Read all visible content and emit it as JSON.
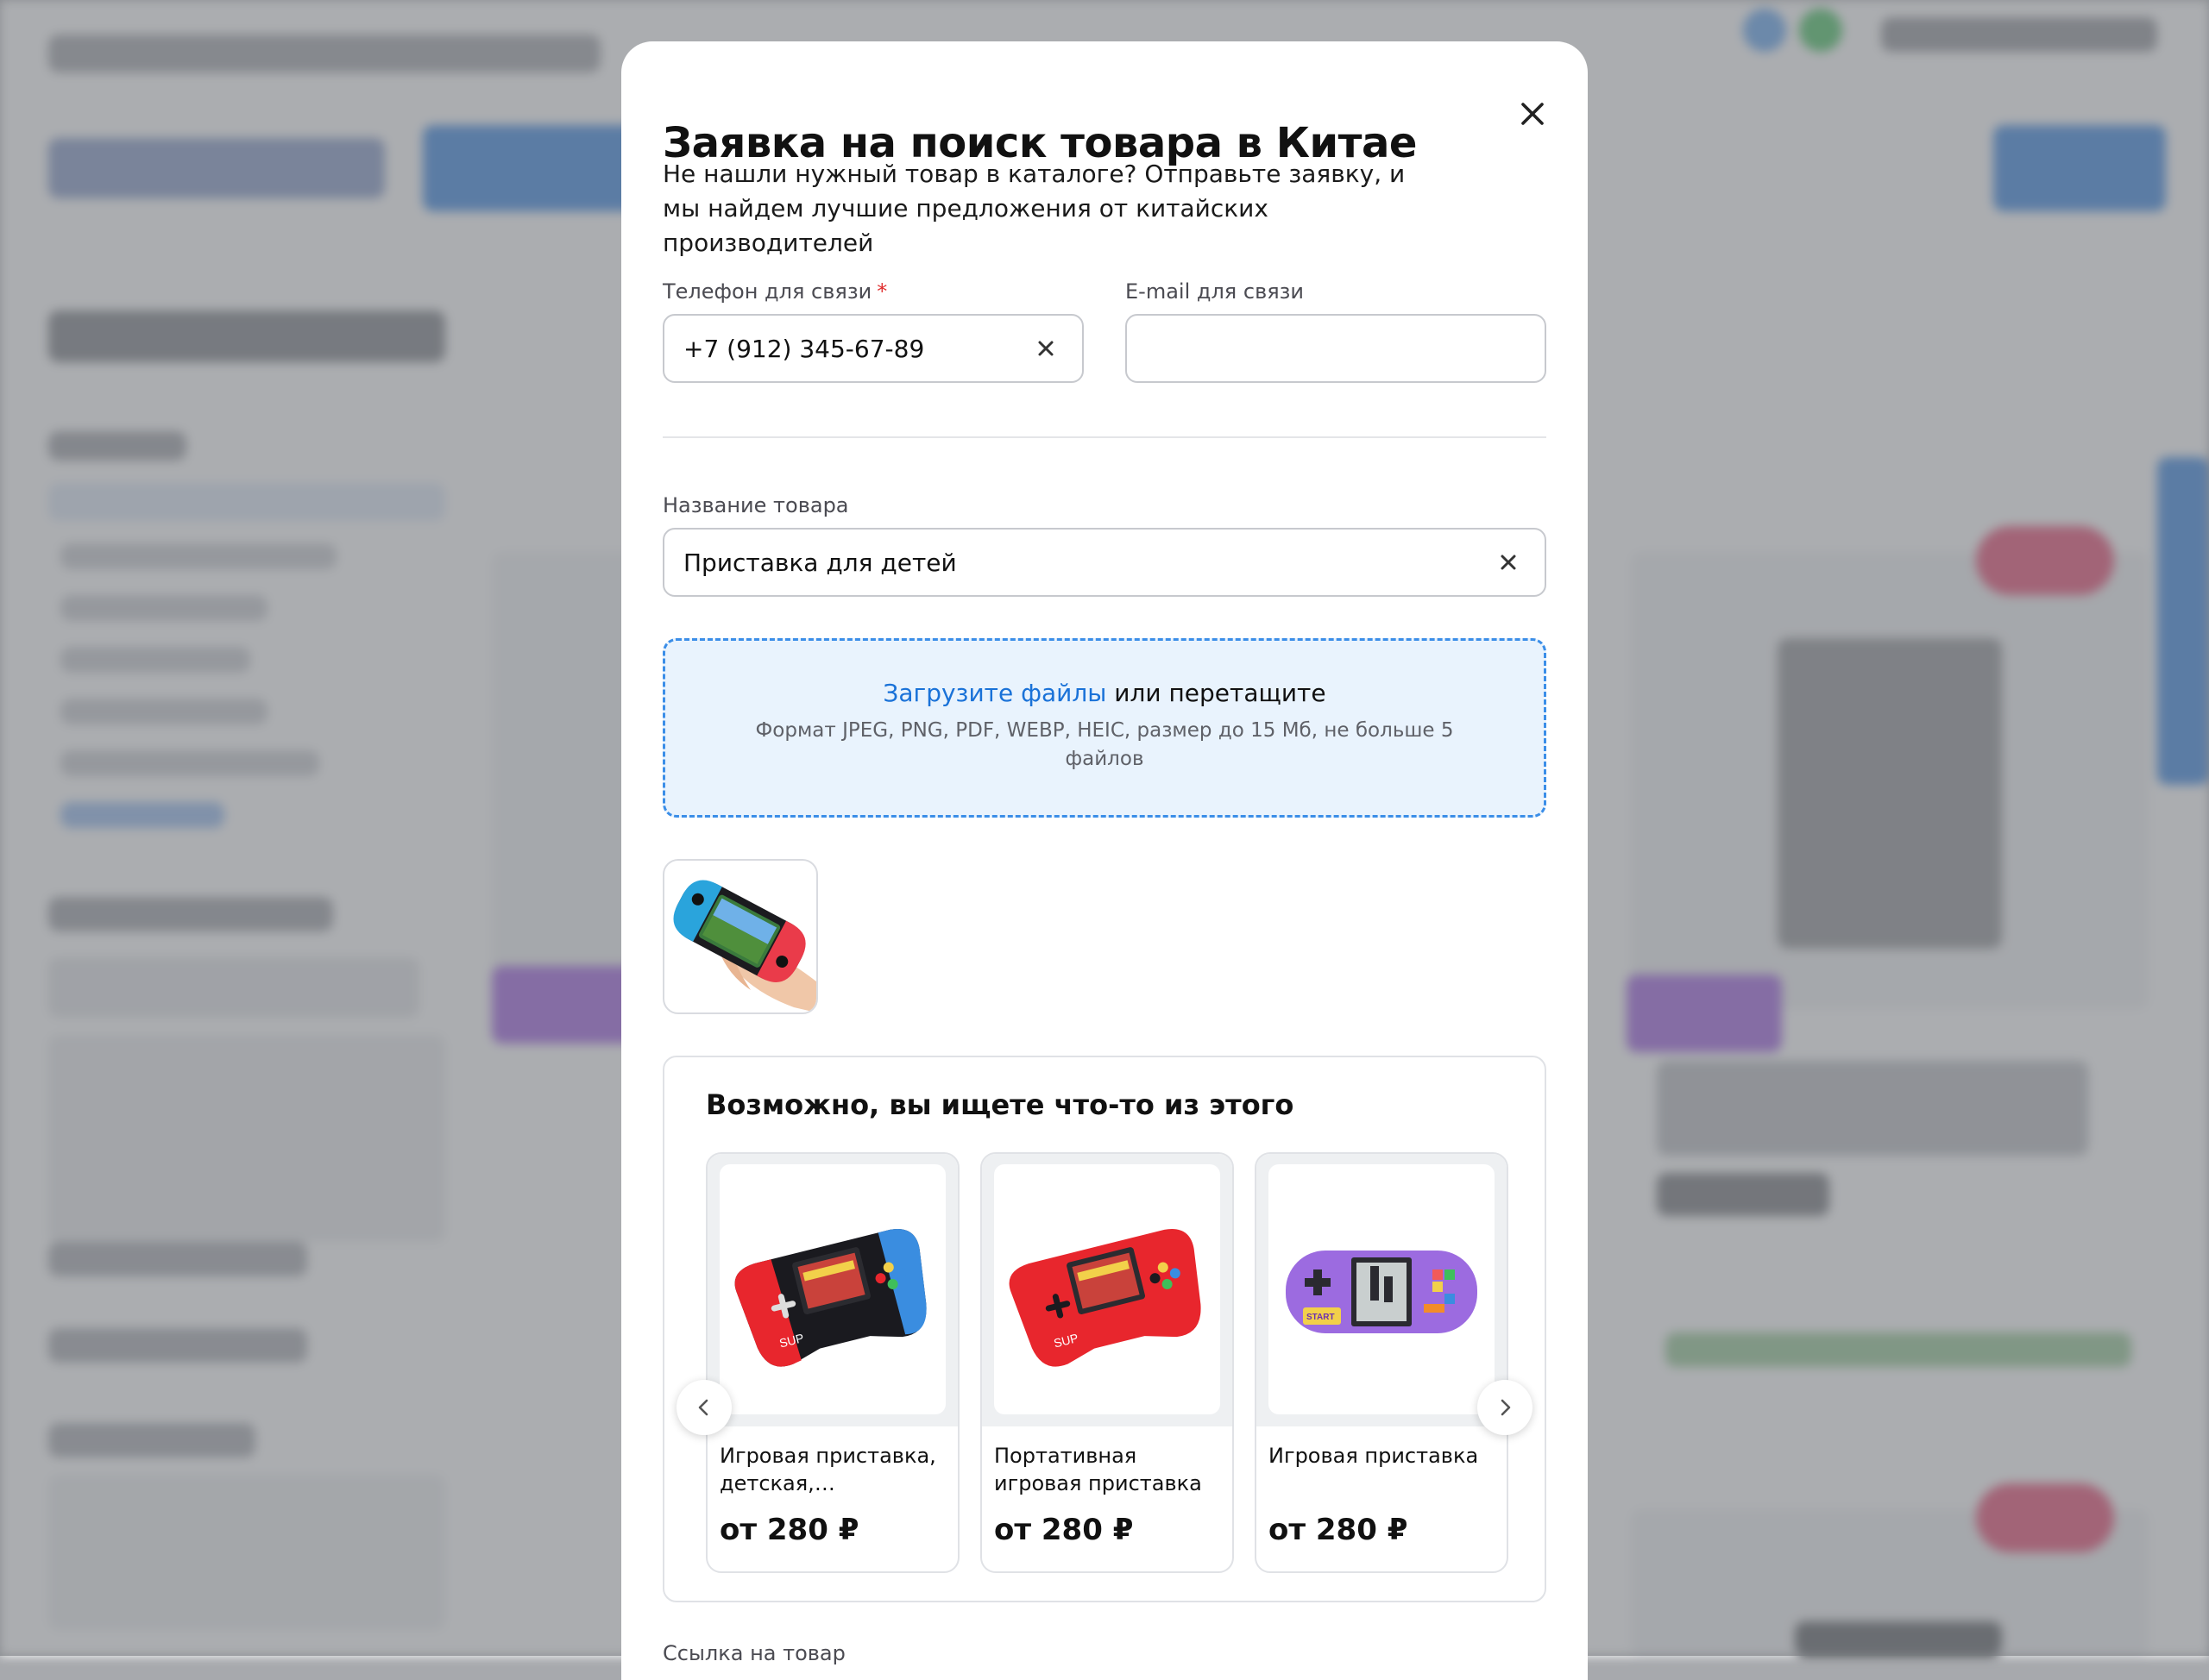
{
  "modal": {
    "title": "Заявка на поиск товара в Китае",
    "subtitle": "Не нашли нужный товар в каталоге? Отправьте заявку, и мы найдем лучшие предложения от китайских производителей",
    "close_icon": "close-icon"
  },
  "form": {
    "phone": {
      "label": "Телефон для связи",
      "required_mark": "*",
      "value": "+7 (912) 345-67-89"
    },
    "email": {
      "label": "E-mail для связи",
      "value": ""
    },
    "product_name": {
      "label": "Название товара",
      "value": "Приставка для детей"
    },
    "upload": {
      "link_text": "Загрузите файлы",
      "rest_text": " или перетащите",
      "hint": "Формат JPEG, PNG, PDF, WEBP, HEIC, размер до 15 Мб, не больше 5 файлов"
    },
    "attached_files": [
      {
        "icon": "handheld-console-photo"
      }
    ],
    "next_field_label": "Ссылка на товар"
  },
  "suggestions": {
    "title": "Возможно, вы ищете что-то из этого",
    "items": [
      {
        "name": "Игровая приставка, детская, мультиколор",
        "price": "от 280 ₽",
        "color": "#e8262d"
      },
      {
        "name": "Портативная игровая приставка",
        "price": "от 280 ₽",
        "color": "#e8262d"
      },
      {
        "name": "Игровая приставка",
        "price": "от 280 ₽",
        "color": "#9c6be0"
      }
    ],
    "prev_icon": "chevron-left-icon",
    "next_icon": "chevron-right-icon"
  },
  "colors": {
    "accent": "#1a72d8",
    "dropzone_bg": "#e9f3fd",
    "required": "#e02d2d"
  }
}
